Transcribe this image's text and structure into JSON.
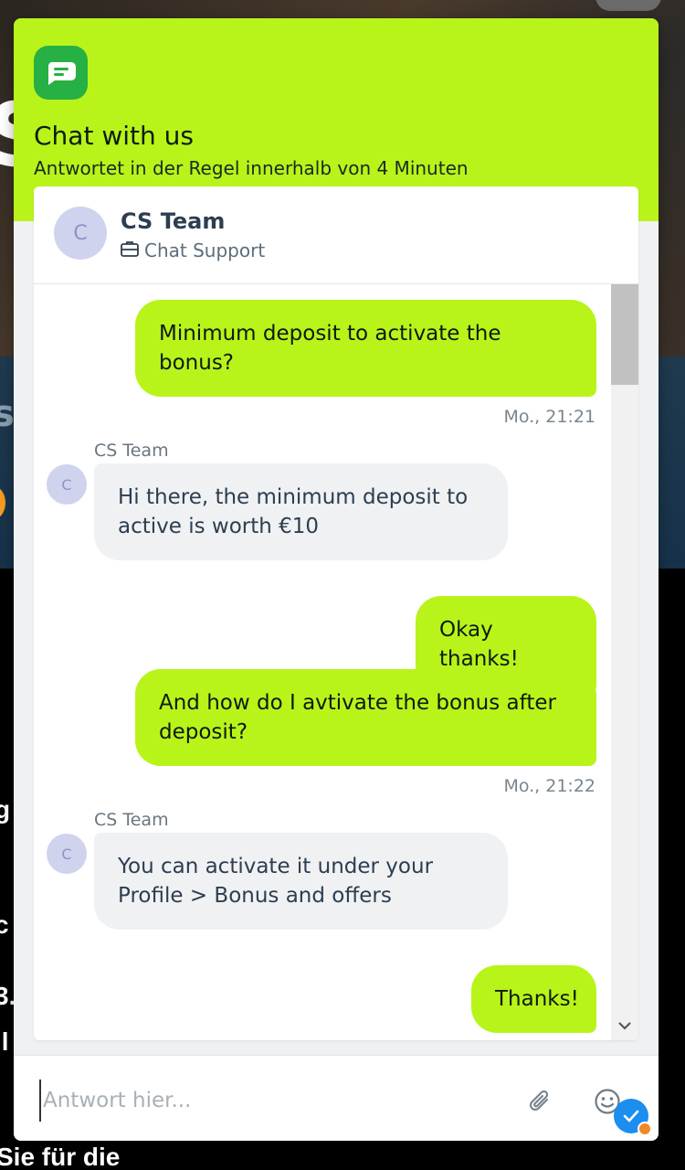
{
  "header": {
    "title": "Chat with us",
    "subtitle": "Antwortet in der Regel innerhalb von 4 Minuten"
  },
  "agent": {
    "initial": "C",
    "name": "CS Team",
    "role": "Chat Support"
  },
  "messages": [
    {
      "direction": "out",
      "text": "Minimum deposit to activate the bonus?",
      "time": "Mo., 21:21"
    },
    {
      "direction": "in",
      "sender": "CS Team",
      "initial": "C",
      "text": "Hi there, the minimum deposit to active is worth €10"
    },
    {
      "direction": "out",
      "text": "Okay thanks!"
    },
    {
      "direction": "out",
      "text": "And how do I avtivate the bonus after deposit?",
      "time": "Mo., 21:22"
    },
    {
      "direction": "in",
      "sender": "CS Team",
      "initial": "C",
      "text": "You can activate it under your Profile > Bonus and offers"
    },
    {
      "direction": "out",
      "text": "Thanks!"
    }
  ],
  "composer": {
    "placeholder": "Antwort hier..."
  },
  "background": {
    "fragment_1": "g",
    "fragment_2": "c",
    "fragment_3": "3.",
    "fragment_4": "ll",
    "fragment_5": "Sie für die"
  },
  "colors": {
    "brand_green": "#b8f41a",
    "logo_green": "#27b043",
    "status_blue": "#1b8ef0",
    "status_orange": "#f08a24"
  },
  "icons": {
    "logo": "chat-bubble-icon",
    "role": "briefcase-icon",
    "attach": "paperclip-icon",
    "emoji": "smiley-icon",
    "status": "check-icon",
    "scroll": "chevron-down-icon"
  }
}
